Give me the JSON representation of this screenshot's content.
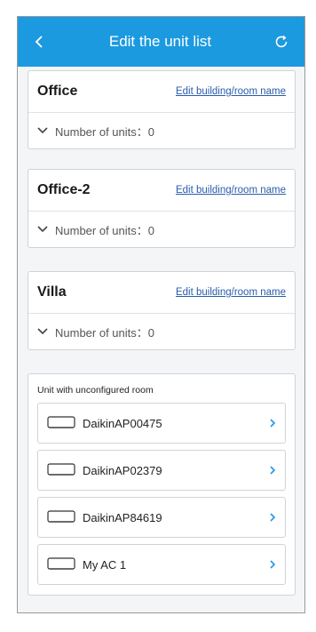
{
  "header": {
    "title": "Edit the unit list",
    "back_icon": "back-arrow-icon",
    "refresh_icon": "refresh-icon",
    "color": "#1c9ae0"
  },
  "rooms": [
    {
      "name": "Office",
      "edit_label": "Edit building/room name",
      "units_label": "Number of units：0"
    },
    {
      "name": "Office-2",
      "edit_label": "Edit building/room name",
      "units_label": "Number of units：0"
    },
    {
      "name": "Villa",
      "edit_label": "Edit building/room name",
      "units_label": "Number of units：0"
    }
  ],
  "unconfigured": {
    "title": "Unit with unconfigured room",
    "units": [
      {
        "name": "DaikinAP00475"
      },
      {
        "name": "DaikinAP02379"
      },
      {
        "name": "DaikinAP84619"
      },
      {
        "name": "My AC 1"
      }
    ]
  }
}
